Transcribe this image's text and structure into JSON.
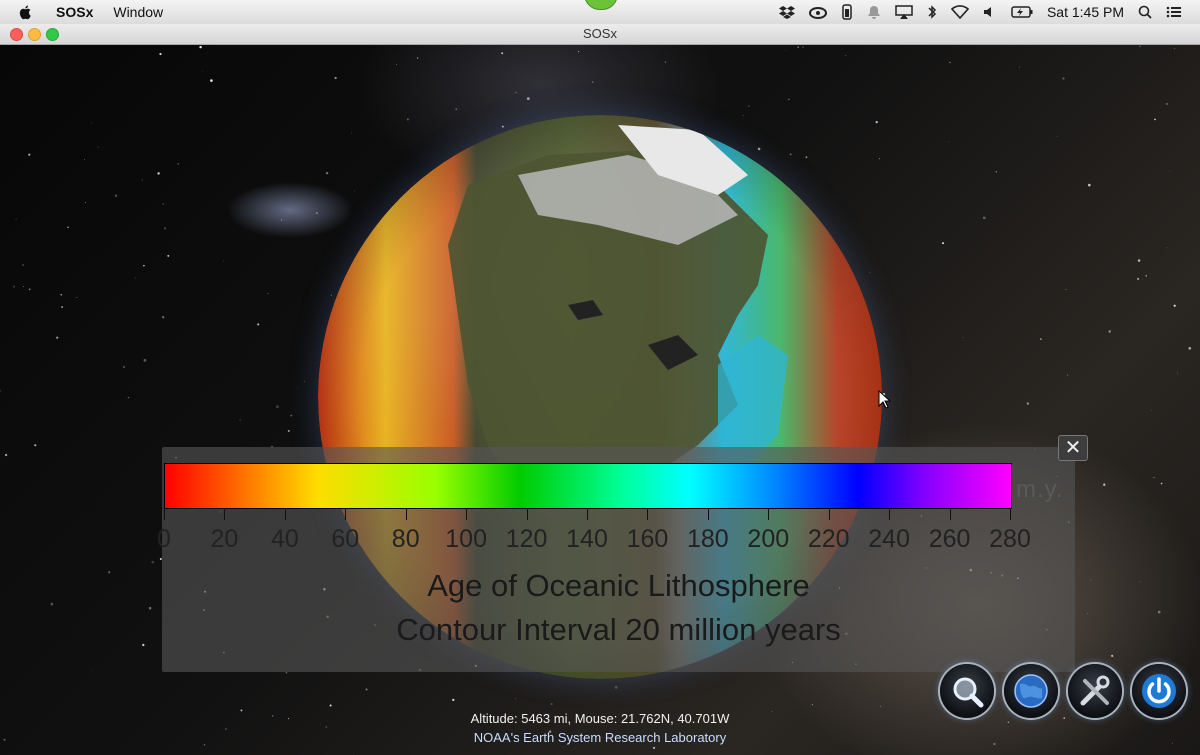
{
  "menubar": {
    "app_name": "SOSx",
    "menu_items": [
      "Window"
    ],
    "clock": "Sat 1:45 PM"
  },
  "window": {
    "title": "SOSx"
  },
  "legend": {
    "units": "m.y.",
    "ticks": [
      "0",
      "20",
      "40",
      "60",
      "80",
      "100",
      "120",
      "140",
      "160",
      "180",
      "200",
      "220",
      "240",
      "260",
      "280"
    ],
    "title_line1": "Age of Oceanic Lithosphere",
    "title_line2": "Contour Interval 20 million years",
    "close_label": "✕"
  },
  "status": {
    "coords": "Altitude: 5463 mi, Mouse: 21.762N, 40.701W",
    "credit": "NOAA's Earth System Research Laboratory"
  },
  "toolbar": {
    "buttons": [
      "search-icon",
      "globe-icon",
      "tools-icon",
      "power-icon"
    ]
  }
}
